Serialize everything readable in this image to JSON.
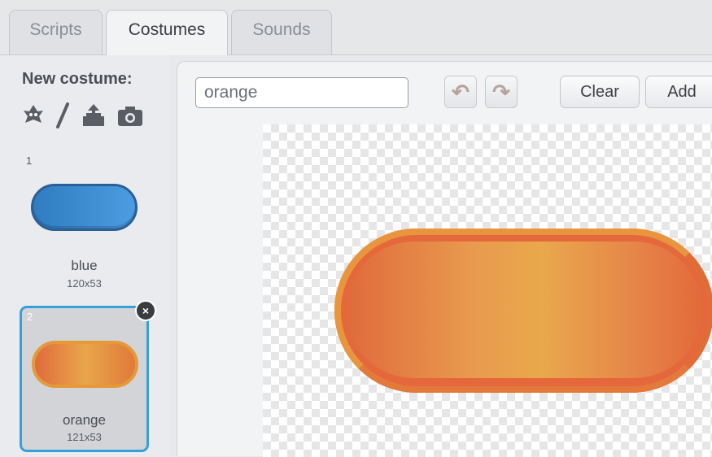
{
  "tabs": [
    {
      "label": "Scripts"
    },
    {
      "label": "Costumes"
    },
    {
      "label": "Sounds"
    }
  ],
  "new_costume": {
    "title": "New costume:",
    "icons": [
      "sprite-library-icon",
      "paint-brush-icon",
      "upload-icon",
      "camera-icon"
    ]
  },
  "costumes": [
    {
      "number": "1",
      "name": "blue",
      "size": "120x53",
      "color": "#3d8ad2"
    },
    {
      "number": "2",
      "name": "orange",
      "size": "121x53",
      "color": "#e8953d"
    }
  ],
  "editor": {
    "costume_name": "orange",
    "undo_icon": "undo-icon",
    "redo_icon": "redo-icon",
    "clear_label": "Clear",
    "add_label": "Add"
  },
  "colors": {
    "selected_border": "#38a0d8",
    "orange_dark": "#e4683c",
    "orange_light": "#e9a84c",
    "blue": "#2f7cc1"
  }
}
